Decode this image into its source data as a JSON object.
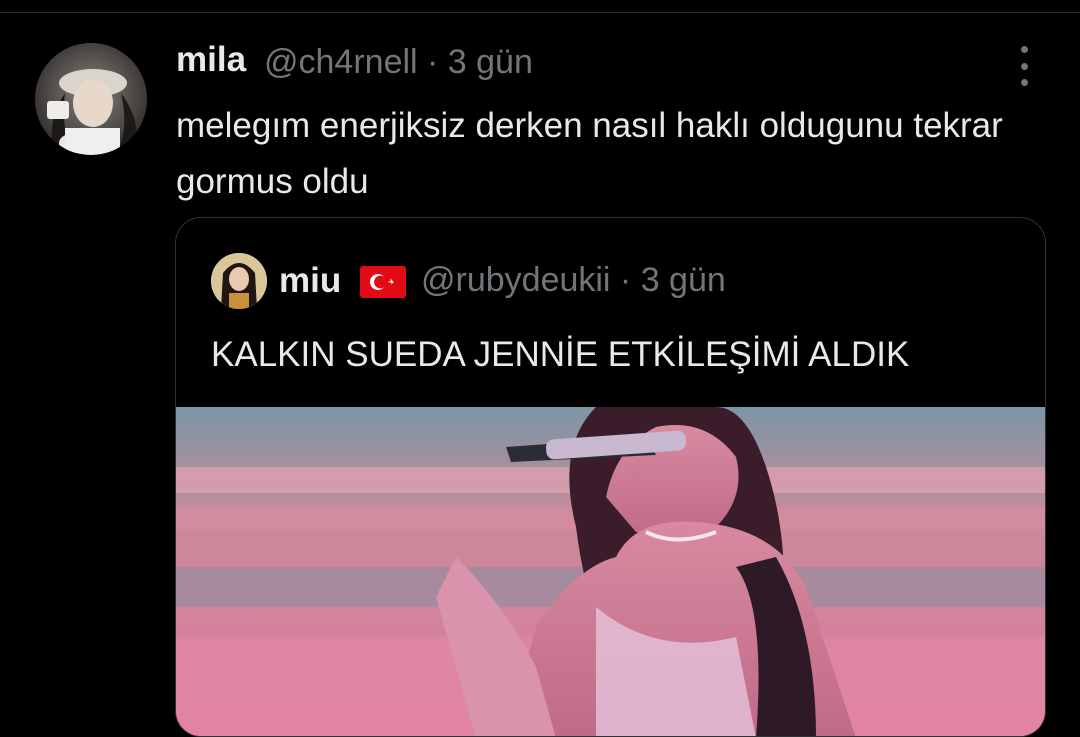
{
  "tweet": {
    "author_name": "mila",
    "author_handle": "@ch4rnell · 3 gün",
    "text": "melegım enerjiksiz derken nasıl haklı oldugunu tekrar gormus oldu",
    "more_icon": "more-vertical-icon"
  },
  "quoted_tweet": {
    "author_name": "miu",
    "flag_icon": "turkey-flag-icon",
    "author_handle": "@rubydeukii · 3 gün",
    "text": "KALKIN SUEDA JENNİE ETKİLEŞİMİ ALDIK"
  },
  "colors": {
    "background": "#000000",
    "primary_text": "#e7e9ea",
    "secondary_text": "#71767b",
    "border": "#2f3336",
    "flag_red": "#e30a17"
  }
}
